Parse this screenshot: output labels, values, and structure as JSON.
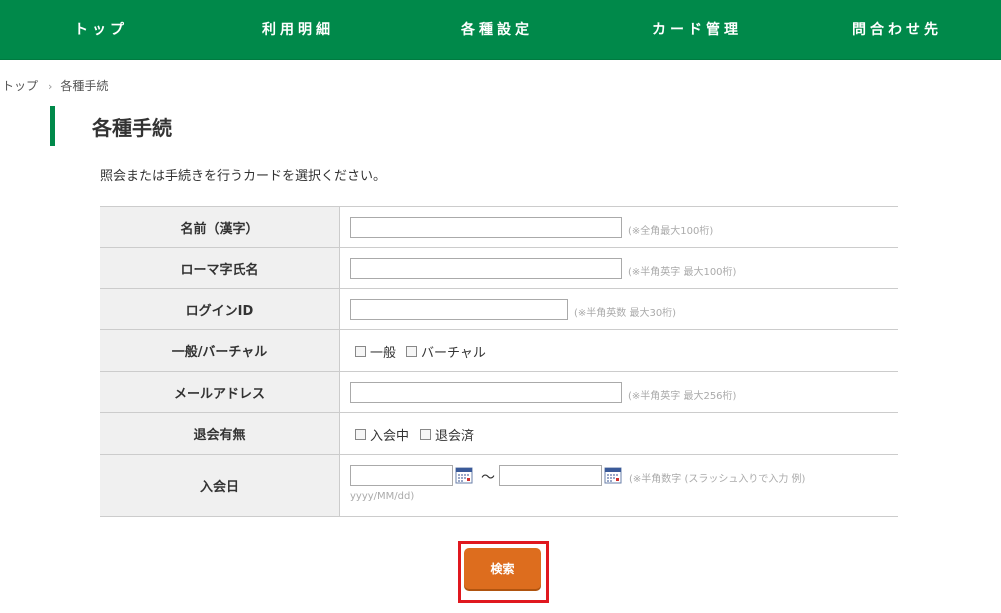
{
  "nav": {
    "items": [
      {
        "label": "トップ"
      },
      {
        "label": "利用明細"
      },
      {
        "label": "各種設定"
      },
      {
        "label": "カード管理"
      },
      {
        "label": "問合わせ先"
      }
    ]
  },
  "breadcrumb": {
    "home": "トップ",
    "separator": "›",
    "current": "各種手続"
  },
  "page": {
    "title": "各種手続",
    "instruction": "照会または手続きを行うカードを選択ください。"
  },
  "form": {
    "name_kanji": {
      "label": "名前（漢字）",
      "value": "",
      "hint": "(※全角最大100桁)"
    },
    "name_roman": {
      "label": "ローマ字氏名",
      "value": "",
      "hint": "(※半角英字 最大100桁)"
    },
    "login_id": {
      "label": "ログインID",
      "value": "",
      "hint": "(※半角英数 最大30桁)"
    },
    "card_type": {
      "label": "一般/バーチャル",
      "options": [
        {
          "label": "一般"
        },
        {
          "label": "バーチャル"
        }
      ]
    },
    "email": {
      "label": "メールアドレス",
      "value": "",
      "hint": "(※半角英字 最大256桁)"
    },
    "withdrawal": {
      "label": "退会有無",
      "options": [
        {
          "label": "入会中"
        },
        {
          "label": "退会済"
        }
      ]
    },
    "join_date": {
      "label": "入会日",
      "from": "",
      "to": "",
      "tilde": "～",
      "hint": "(※半角数字 (スラッシュ入りで入力 例)",
      "hint2": "yyyy/MM/dd)"
    }
  },
  "search": {
    "label": "検索"
  },
  "colors": {
    "brand": "#00894a",
    "button": "#dd6d1e",
    "highlight": "#e0181f"
  }
}
